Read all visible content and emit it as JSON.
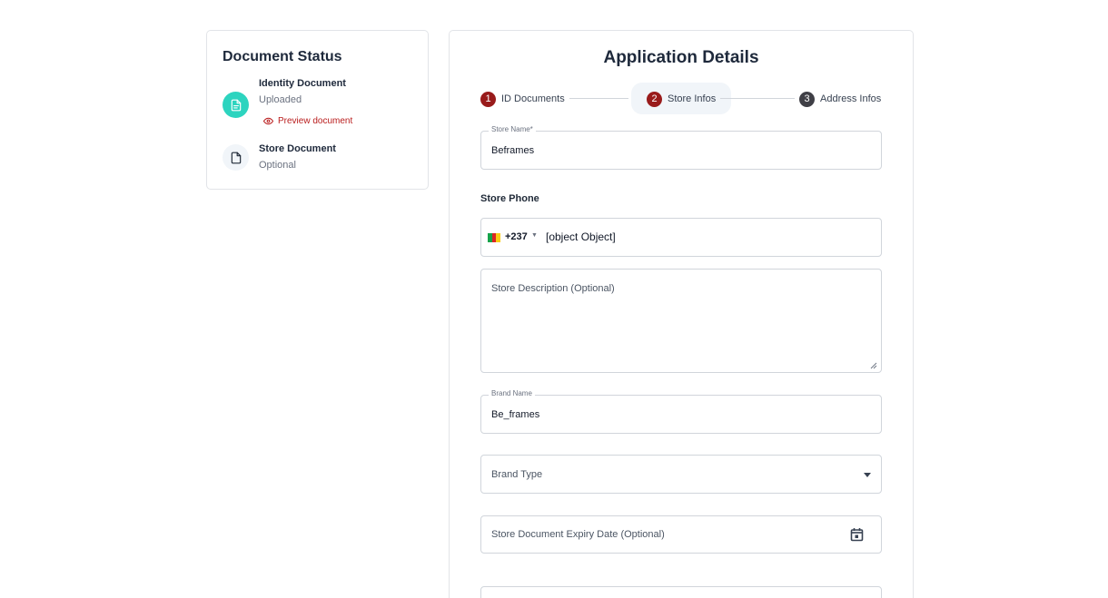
{
  "document_status": {
    "title": "Document Status",
    "documents": [
      {
        "name": "Identity Document",
        "status": "Uploaded",
        "icon": "document-filled-icon",
        "action": "Preview document"
      },
      {
        "name": "Store Document",
        "status": "Optional",
        "icon": "document-outline-icon"
      }
    ]
  },
  "application": {
    "title": "Application Details",
    "steps": [
      {
        "number": "1",
        "label": "ID Documents"
      },
      {
        "number": "2",
        "label": "Store Infos"
      },
      {
        "number": "3",
        "label": "Address Infos"
      }
    ],
    "active_step_index": 1,
    "fields": {
      "store_name": {
        "label": "Store Name*",
        "value": "Beframes"
      },
      "store_phone": {
        "label": "Store Phone",
        "country_code": "+237",
        "value": "[object Object]",
        "flag": "cameroon-flag-icon"
      },
      "store_description": {
        "placeholder": "Store Description (Optional)"
      },
      "brand_name": {
        "label": "Brand Name",
        "value": "Be_frames"
      },
      "brand_type": {
        "placeholder": "Brand Type"
      },
      "store_document_expiry": {
        "placeholder": "Store Document Expiry Date (Optional)",
        "icon": "calendar-icon"
      }
    }
  },
  "colors": {
    "accent_red": "#991b1b",
    "success_teal": "#2dd4bf",
    "link_red": "#b91c1c"
  }
}
